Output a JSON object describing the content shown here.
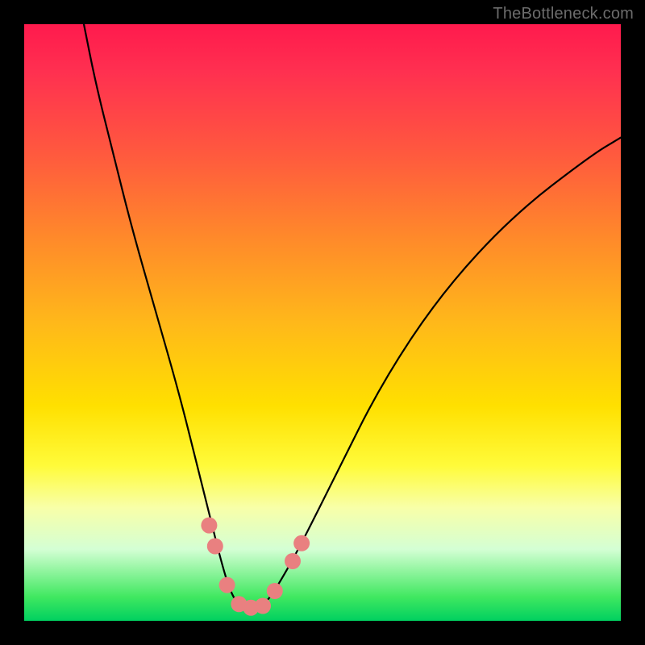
{
  "watermark": "TheBottleneck.com",
  "chart_data": {
    "type": "line",
    "title": "",
    "xlabel": "",
    "ylabel": "",
    "xlim": [
      0,
      100
    ],
    "ylim": [
      0,
      100
    ],
    "curve": {
      "x": [
        10,
        12,
        15,
        18,
        22,
        26,
        29,
        31,
        33,
        34.5,
        36,
        38,
        40,
        42,
        46,
        52,
        60,
        70,
        82,
        95,
        100
      ],
      "y": [
        100,
        90,
        78,
        66,
        52,
        38,
        26,
        18,
        10,
        5,
        2.5,
        2,
        2.5,
        5,
        12,
        24,
        40,
        55,
        68,
        78,
        81
      ]
    },
    "beads": [
      {
        "x": 31.0,
        "y": 16.0
      },
      {
        "x": 32.0,
        "y": 12.5
      },
      {
        "x": 34.0,
        "y": 6.0
      },
      {
        "x": 36.0,
        "y": 2.8
      },
      {
        "x": 38.0,
        "y": 2.2
      },
      {
        "x": 40.0,
        "y": 2.5
      },
      {
        "x": 42.0,
        "y": 5.0
      },
      {
        "x": 45.0,
        "y": 10.0
      },
      {
        "x": 46.5,
        "y": 13.0
      }
    ],
    "bead_color": "#e98080",
    "bead_radius_px": 10,
    "curve_stroke": "#000000",
    "curve_stroke_width": 2.2
  }
}
